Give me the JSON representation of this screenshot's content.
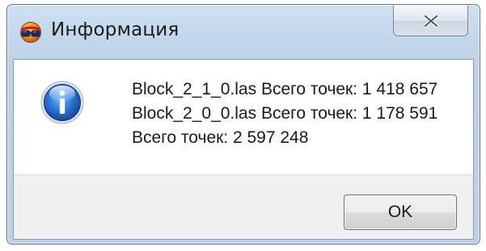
{
  "window": {
    "title": "Информация",
    "app_icon": "glasses-app-icon",
    "close_icon": "close-icon"
  },
  "message": {
    "icon": "info-icon",
    "lines": [
      "Block_2_1_0.las Всего точек: 1 418 657",
      "Block_2_0_0.las Всего точек: 1 178 591",
      "Всего точек: 2 597 248"
    ]
  },
  "buttons": {
    "ok_label": "OK"
  },
  "colors": {
    "frame": "#c3d7ec",
    "info_icon": "#1f5fb8",
    "button_bar": "#f0f0f0"
  }
}
